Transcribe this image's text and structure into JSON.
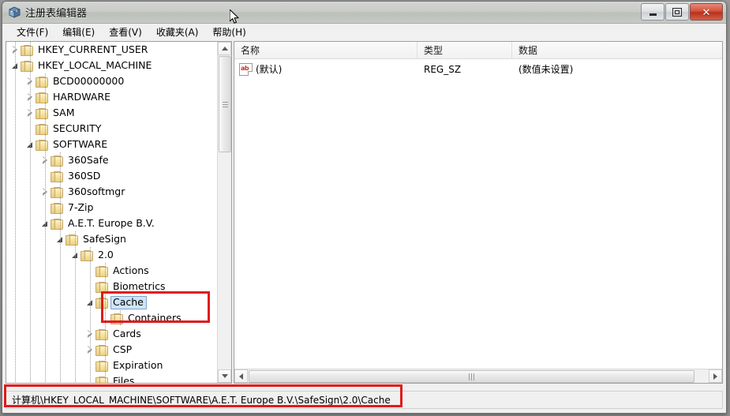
{
  "window": {
    "title": "注册表编辑器",
    "icon": "registry-editor-icon",
    "controls": {
      "minimize": "–",
      "maximize": "❐",
      "close": "✕"
    }
  },
  "menubar": {
    "items": [
      {
        "label": "文件(F)",
        "name": "menu-file"
      },
      {
        "label": "编辑(E)",
        "name": "menu-edit"
      },
      {
        "label": "查看(V)",
        "name": "menu-view"
      },
      {
        "label": "收藏夹(A)",
        "name": "menu-favorites"
      },
      {
        "label": "帮助(H)",
        "name": "menu-help"
      }
    ]
  },
  "tree": {
    "items": [
      {
        "label": "HKEY_CURRENT_USER",
        "depth": 1,
        "state": "collapsed",
        "selected": false
      },
      {
        "label": "HKEY_LOCAL_MACHINE",
        "depth": 1,
        "state": "expanded",
        "selected": false
      },
      {
        "label": "BCD00000000",
        "depth": 2,
        "state": "collapsed",
        "selected": false
      },
      {
        "label": "HARDWARE",
        "depth": 2,
        "state": "collapsed",
        "selected": false
      },
      {
        "label": "SAM",
        "depth": 2,
        "state": "collapsed",
        "selected": false
      },
      {
        "label": "SECURITY",
        "depth": 2,
        "state": "leaf",
        "selected": false
      },
      {
        "label": "SOFTWARE",
        "depth": 2,
        "state": "expanded",
        "selected": false
      },
      {
        "label": "360Safe",
        "depth": 3,
        "state": "collapsed",
        "selected": false
      },
      {
        "label": "360SD",
        "depth": 3,
        "state": "leaf",
        "selected": false
      },
      {
        "label": "360softmgr",
        "depth": 3,
        "state": "collapsed",
        "selected": false
      },
      {
        "label": "7-Zip",
        "depth": 3,
        "state": "leaf",
        "selected": false
      },
      {
        "label": "A.E.T. Europe B.V.",
        "depth": 3,
        "state": "expanded",
        "selected": false
      },
      {
        "label": "SafeSign",
        "depth": 4,
        "state": "expanded",
        "selected": false
      },
      {
        "label": "2.0",
        "depth": 5,
        "state": "expanded",
        "selected": false
      },
      {
        "label": "Actions",
        "depth": 6,
        "state": "leaf",
        "selected": false
      },
      {
        "label": "Biometrics",
        "depth": 6,
        "state": "leaf",
        "selected": false
      },
      {
        "label": "Cache",
        "depth": 6,
        "state": "expanded",
        "selected": true
      },
      {
        "label": "Containers",
        "depth": 7,
        "state": "leaf",
        "selected": false
      },
      {
        "label": "Cards",
        "depth": 6,
        "state": "collapsed",
        "selected": false
      },
      {
        "label": "CSP",
        "depth": 6,
        "state": "collapsed",
        "selected": false
      },
      {
        "label": "Expiration",
        "depth": 6,
        "state": "leaf",
        "selected": false
      },
      {
        "label": "Files",
        "depth": 6,
        "state": "leaf",
        "selected": false
      }
    ]
  },
  "list": {
    "columns": [
      {
        "label": "名称",
        "name": "column-name"
      },
      {
        "label": "类型",
        "name": "column-type"
      },
      {
        "label": "数据",
        "name": "column-data"
      }
    ],
    "rows": [
      {
        "icon": "string-value-icon",
        "name": "(默认)",
        "type": "REG_SZ",
        "data": "(数值未设置)"
      }
    ]
  },
  "statusbar": {
    "path": "计算机\\HKEY_LOCAL_MACHINE\\SOFTWARE\\A.E.T. Europe B.V.\\SafeSign\\2.0\\Cache"
  },
  "colors": {
    "annotation": "#e01b1b",
    "selection": "#cfe4f7",
    "folder": "#f0d68a",
    "close_button": "#c0392b"
  }
}
